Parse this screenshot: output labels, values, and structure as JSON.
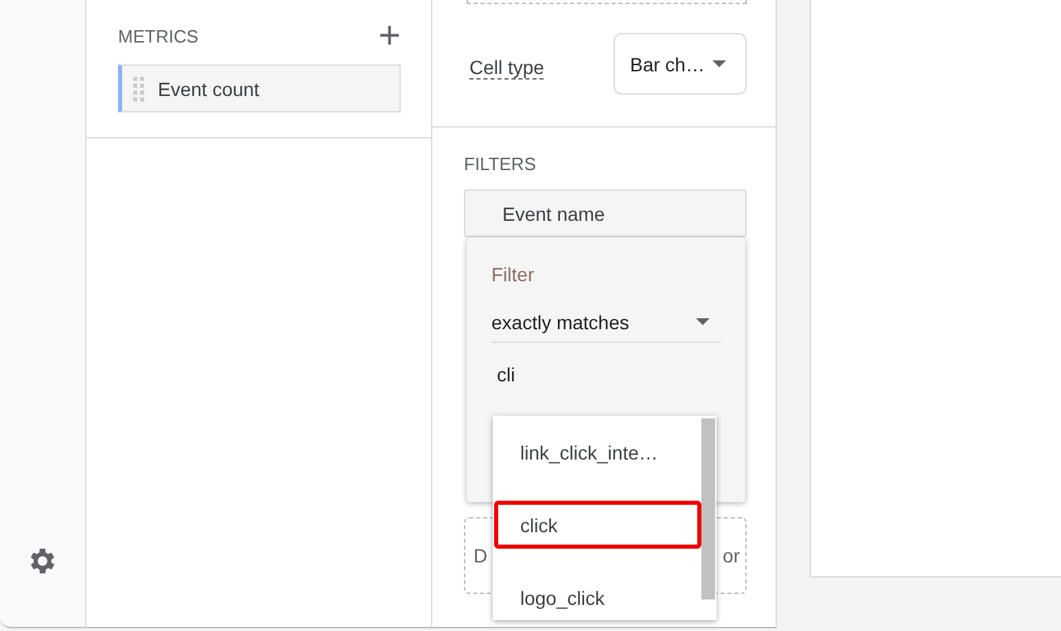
{
  "metrics": {
    "title": "METRICS",
    "add_icon": "+",
    "items": [
      {
        "label": "Event count"
      }
    ]
  },
  "cell_type": {
    "label": "Cell type",
    "value": "Bar ch…"
  },
  "filters": {
    "title": "FILTERS",
    "chip": "Event name",
    "drop_hint_start": "D",
    "drop_hint_end": "or",
    "popup": {
      "label": "Filter",
      "match_type": "exactly matches",
      "value": "cli",
      "suggestions": [
        {
          "label": "link_click_inte…",
          "selected": false
        },
        {
          "label": "click",
          "selected": true
        },
        {
          "label": "logo_click",
          "selected": false
        }
      ]
    }
  }
}
